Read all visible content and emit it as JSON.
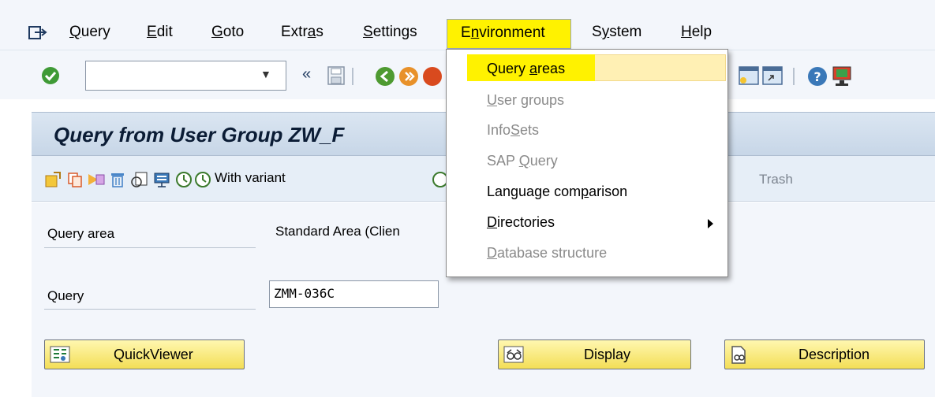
{
  "menubar": {
    "items": {
      "query": {
        "prefix": "",
        "u": "Q",
        "rest": "uery"
      },
      "edit": {
        "prefix": "",
        "u": "E",
        "rest": "dit"
      },
      "goto": {
        "prefix": "",
        "u": "G",
        "rest": "oto"
      },
      "extras": {
        "prefix": "Extr",
        "u": "a",
        "rest": "s"
      },
      "settings": {
        "prefix": "",
        "u": "S",
        "rest": "ettings"
      },
      "environment": {
        "prefix": "E",
        "u": "n",
        "rest": "vironment"
      },
      "system": {
        "prefix": "S",
        "u": "y",
        "rest": "stem"
      },
      "help": {
        "prefix": "",
        "u": "H",
        "rest": "elp"
      }
    }
  },
  "dropdown": {
    "query_areas": {
      "prefix": "Query ",
      "u": "a",
      "rest": "reas"
    },
    "user_groups": {
      "prefix": "",
      "u": "U",
      "rest": "ser groups"
    },
    "infosets": {
      "prefix": "Info",
      "u": "S",
      "rest": "ets"
    },
    "sap_query": {
      "prefix": "SAP ",
      "u": "Q",
      "rest": "uery"
    },
    "language_comparison": {
      "prefix": "Language com",
      "u": "p",
      "rest": "arison"
    },
    "directories": {
      "prefix": "",
      "u": "D",
      "rest": "irectories"
    },
    "database_structure": {
      "prefix": "",
      "u": "D",
      "rest": "atabase structure"
    }
  },
  "title": "Query from User Group ZW_F",
  "app_toolbar": {
    "with_variant": "With variant",
    "trash": "Trash"
  },
  "form": {
    "query_area_label": "Query area",
    "query_area_value": "Standard Area (Clien",
    "query_label": "Query",
    "query_value": "ZMM-036C"
  },
  "buttons": {
    "quickviewer": "QuickViewer",
    "display": "Display",
    "description": "Description"
  },
  "colors": {
    "highlight": "#fff200",
    "button_bg": "#f3de56",
    "title_band": "#c7d6e7"
  }
}
